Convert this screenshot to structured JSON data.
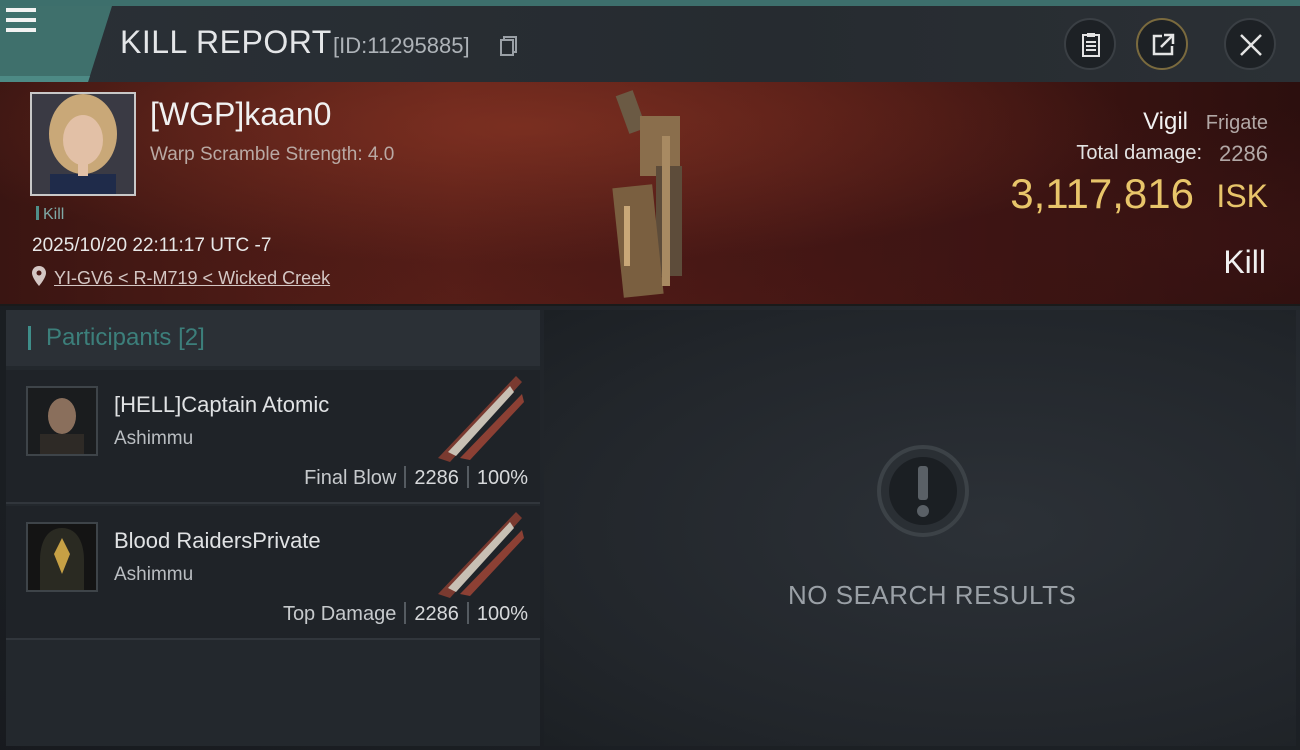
{
  "header": {
    "title": "KILL REPORT",
    "report_id": "[ID:11295885]"
  },
  "victim": {
    "pilot_name": "[WGP]kaan0",
    "warp_scramble": "Warp Scramble Strength: 4.0",
    "kill_tag": "Kill",
    "datetime": "2025/10/20 22:11:17 UTC -7",
    "location": "YI-GV6 < R-M719 < Wicked Creek",
    "ship_name": "Vigil",
    "ship_class": "Frigate",
    "total_damage_label": "Total damage:",
    "total_damage": "2286",
    "isk_value": "3,117,816",
    "isk_unit": "ISK",
    "result": "Kill"
  },
  "participants": {
    "title": "Participants",
    "count": "[2]",
    "items": [
      {
        "name": "[HELL]Captain Atomic",
        "ship": "Ashimmu",
        "tag": "Final Blow",
        "damage": "2286",
        "percent": "100%"
      },
      {
        "name": "Blood RaidersPrivate",
        "ship": "Ashimmu",
        "tag": "Top Damage",
        "damage": "2286",
        "percent": "100%"
      }
    ]
  },
  "details": {
    "empty_message": "NO SEARCH RESULTS"
  },
  "icons": {
    "menu": "menu-icon",
    "copy": "copy-icon",
    "clipboard": "clipboard-icon",
    "share": "share-icon",
    "close": "close-icon",
    "location": "location-pin-icon",
    "empty": "exclamation-icon"
  },
  "colors": {
    "accent_teal": "#3f8e8a",
    "isk_gold": "#e8c56a",
    "banner_red": "#5a1f18"
  }
}
